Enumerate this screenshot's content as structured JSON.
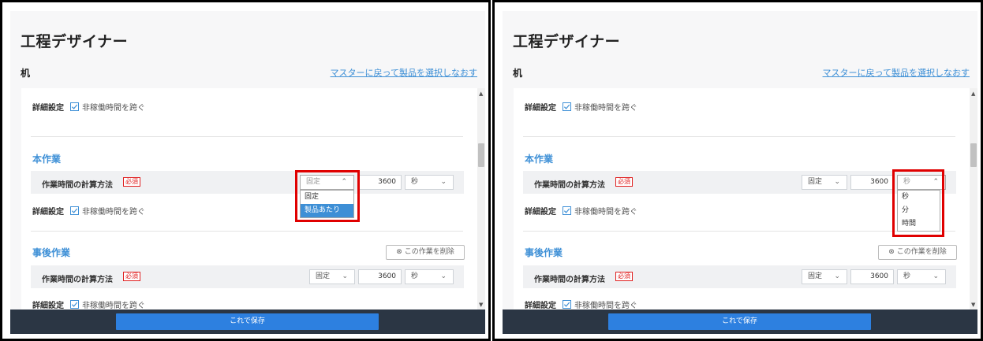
{
  "app_title": "工程デザイナー",
  "product_name": "机",
  "back_link": "マスターに戻って製品を選択しなおす",
  "detail_label": "詳細設定",
  "nonworking_checkbox_label": "非稼働時間を跨ぐ",
  "sections": {
    "main": {
      "title": "本作業"
    },
    "post": {
      "title": "事後作業",
      "delete_label": "この作業を削除"
    }
  },
  "method_label": "作業時間の計算方法",
  "required_badge": "必須",
  "method_selected": "固定",
  "duration_value": "3600",
  "unit_selected": "秒",
  "method_options": [
    "固定",
    "製品あたり"
  ],
  "unit_options": [
    "秒",
    "分",
    "時間"
  ],
  "save_label": "これで保存",
  "colors": {
    "accent": "#3d8fd6",
    "footer": "#2b3644",
    "save_button": "#2d80e0",
    "required": "#e02020",
    "highlight": "#e00000"
  }
}
